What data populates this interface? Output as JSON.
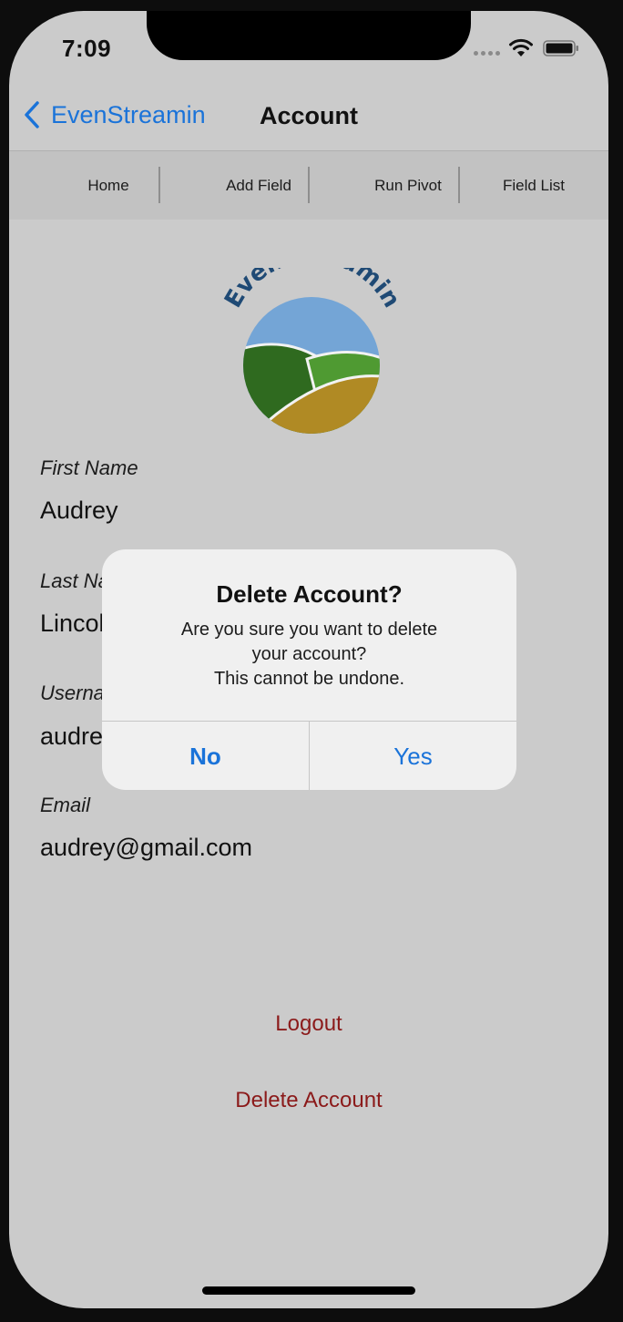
{
  "status_bar": {
    "time": "7:09"
  },
  "nav": {
    "back_label": "EvenStreamin",
    "title": "Account"
  },
  "tabs": [
    {
      "label": "Home"
    },
    {
      "label": "Add Field"
    },
    {
      "label": "Run Pivot"
    },
    {
      "label": "Field List"
    }
  ],
  "logo": {
    "text": "EvenStreamin",
    "colors": {
      "sky": "#74a5d6",
      "dark_green": "#2f6a1f",
      "light_green": "#4f9a32",
      "gold": "#b08a24",
      "text": "#1f4a75"
    }
  },
  "fields": {
    "first_name": {
      "label": "First Name",
      "value": "Audrey"
    },
    "last_name": {
      "label": "Last Name",
      "value": "Lincoln"
    },
    "username": {
      "label": "Username",
      "value": "audrey"
    },
    "email": {
      "label": "Email",
      "value": "audrey@gmail.com"
    }
  },
  "actions": {
    "logout": "Logout",
    "delete_account": "Delete Account"
  },
  "dialog": {
    "title": "Delete Account?",
    "message_line1": "Are you sure you want to delete",
    "message_line2": "your account?",
    "message_line3": "This cannot be undone.",
    "no_label": "No",
    "yes_label": "Yes"
  },
  "colors": {
    "accent": "#1a73d9",
    "danger_text": "#8b1a1a",
    "background": "#cbcbcb"
  }
}
